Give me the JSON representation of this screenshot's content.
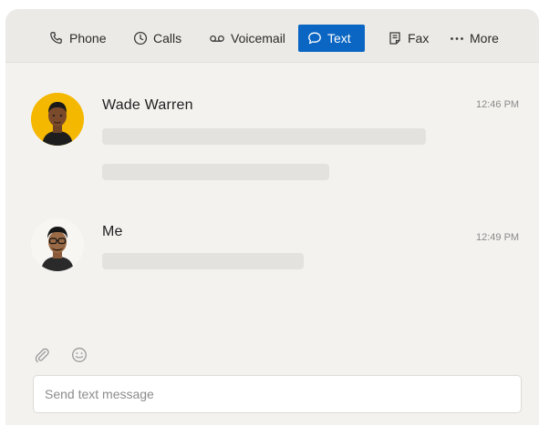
{
  "toolbar": {
    "tabs": [
      {
        "label": "Phone",
        "icon": "phone-icon"
      },
      {
        "label": "Calls",
        "icon": "clock-icon"
      },
      {
        "label": "Voicemail",
        "icon": "voicemail-icon"
      },
      {
        "label": "Text",
        "icon": "chat-bubble-icon",
        "active": true
      },
      {
        "label": "Fax",
        "icon": "fax-icon"
      },
      {
        "label": "More",
        "icon": "more-dots-icon"
      }
    ]
  },
  "messages": [
    {
      "sender": "Wade Warren",
      "time": "12:46 PM",
      "avatar_bg": "#f5b800"
    },
    {
      "sender": "Me",
      "time": "12:49 PM",
      "avatar_bg": "#ffffff"
    }
  ],
  "composer": {
    "placeholder": "Send text message",
    "attach_icon": "paperclip-icon",
    "emoji_icon": "emoji-icon"
  },
  "colors": {
    "accent": "#0a66c2",
    "background": "#f3f2ef",
    "toolbar": "#ebeae6",
    "placeholder_bar": "#e3e2de"
  }
}
